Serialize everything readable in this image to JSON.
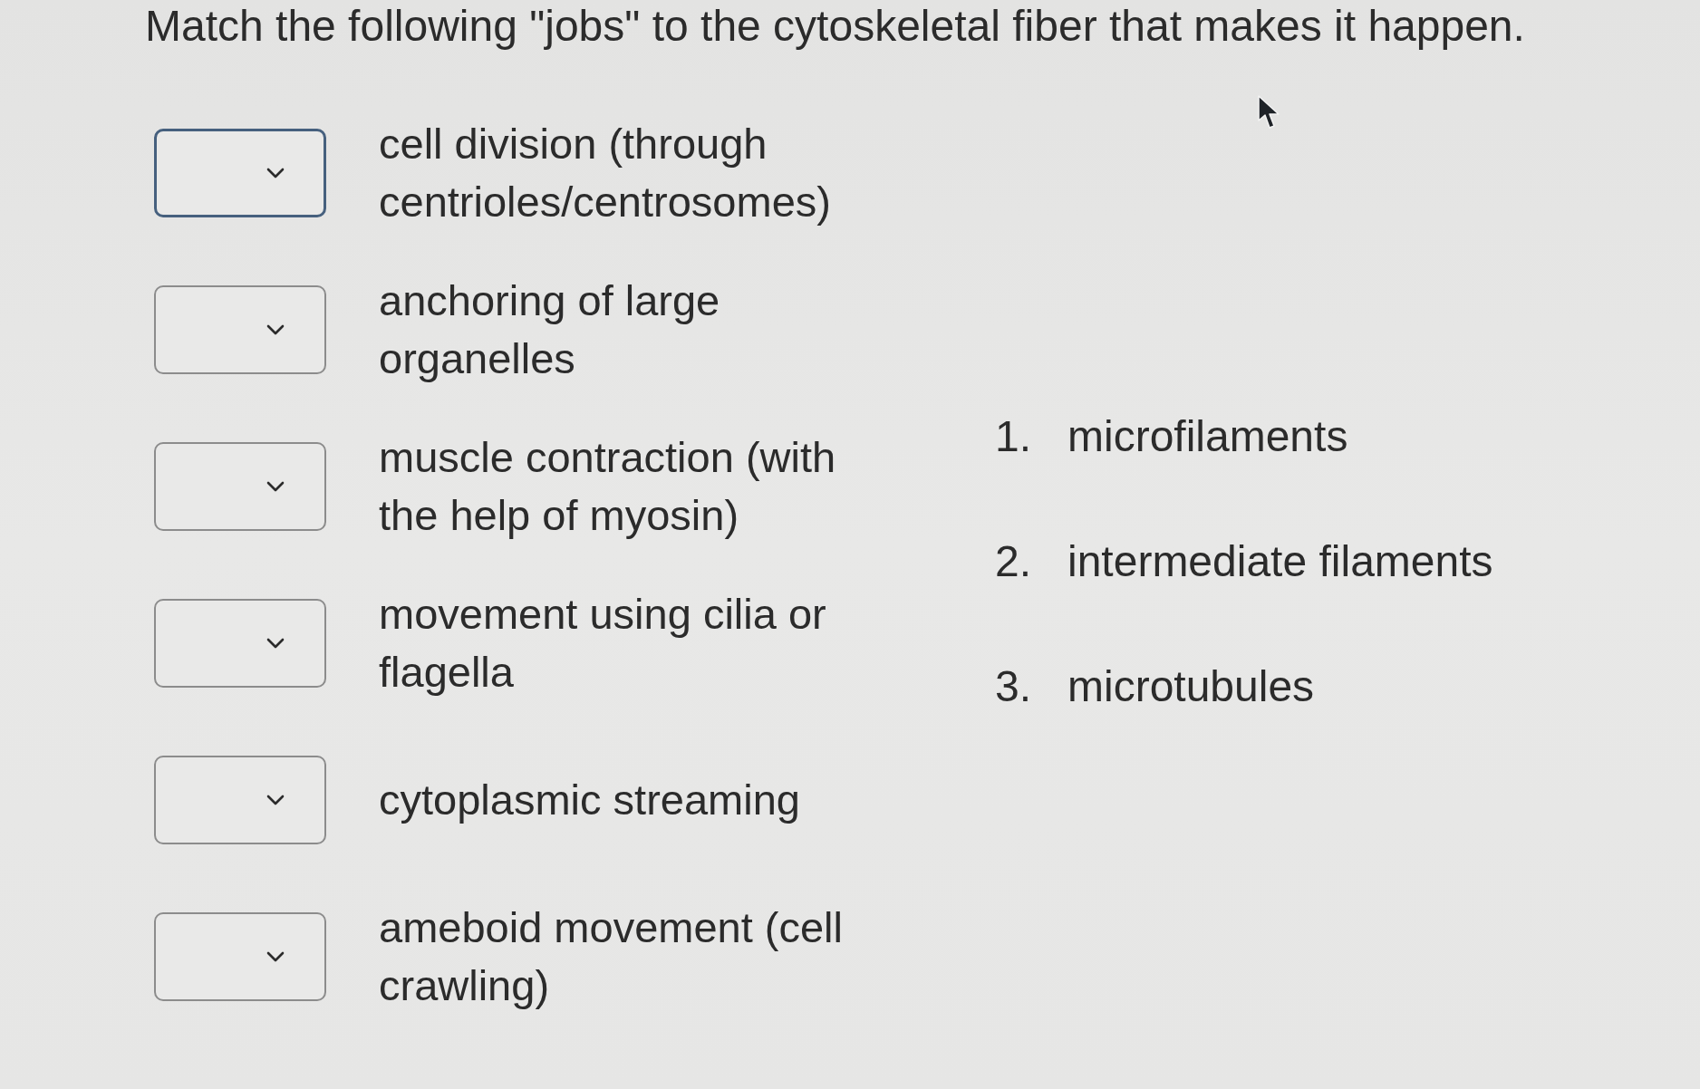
{
  "question": {
    "text": "Match the following \"jobs\" to the cytoskeletal fiber that makes it happen."
  },
  "items": [
    {
      "label": "cell division (through centrioles/centrosomes)",
      "focused": true
    },
    {
      "label": "anchoring of large organelles",
      "focused": false
    },
    {
      "label": "muscle contraction (with the help of myosin)",
      "focused": false
    },
    {
      "label": "movement using cilia or flagella",
      "focused": false
    },
    {
      "label": "cytoplasmic streaming",
      "focused": false
    },
    {
      "label": "ameboid movement (cell crawling)",
      "focused": false
    }
  ],
  "choices": [
    {
      "number": "1.",
      "label": "microfilaments"
    },
    {
      "number": "2.",
      "label": "intermediate filaments"
    },
    {
      "number": "3.",
      "label": "microtubules"
    }
  ]
}
